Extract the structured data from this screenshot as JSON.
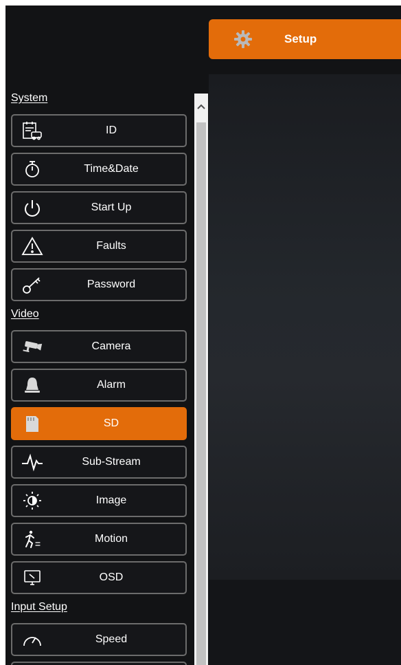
{
  "header": {
    "setup_tab_label": "Setup",
    "accent_color": "#e36c0a"
  },
  "sidebar": {
    "sections": [
      {
        "title": "System",
        "items": [
          {
            "label": "ID",
            "icon": "id-card-icon"
          },
          {
            "label": "Time&Date",
            "icon": "stopwatch-icon"
          },
          {
            "label": "Start Up",
            "icon": "power-icon"
          },
          {
            "label": "Faults",
            "icon": "warning-icon"
          },
          {
            "label": "Password",
            "icon": "key-icon"
          }
        ]
      },
      {
        "title": "Video",
        "items": [
          {
            "label": "Camera",
            "icon": "camera-icon"
          },
          {
            "label": "Alarm",
            "icon": "bell-icon"
          },
          {
            "label": "SD",
            "icon": "sd-card-icon",
            "active": true
          },
          {
            "label": "Sub-Stream",
            "icon": "waveform-icon"
          },
          {
            "label": "Image",
            "icon": "brightness-icon"
          },
          {
            "label": "Motion",
            "icon": "running-person-icon"
          },
          {
            "label": "OSD",
            "icon": "monitor-icon"
          }
        ]
      },
      {
        "title": "Input Setup",
        "items": [
          {
            "label": "Speed",
            "icon": "speedometer-icon"
          }
        ]
      }
    ]
  }
}
